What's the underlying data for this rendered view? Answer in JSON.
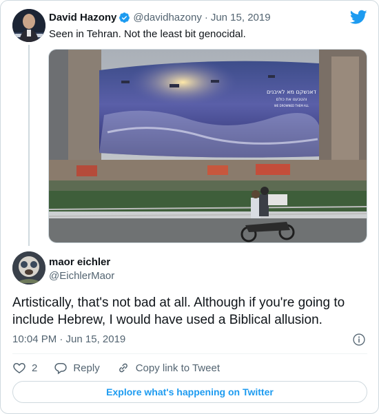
{
  "parent_tweet": {
    "author_name": "David Hazony",
    "handle": "@davidhazony",
    "separator": "·",
    "date": "Jun 15, 2019",
    "text": "Seen in Tehran. Not the least bit genocidal.",
    "billboard_lines": [
      "דאנשקם מא לאיבנים",
      "והטבענו את כולם",
      "WE DROWNED THEM ALL"
    ],
    "icons": {
      "verified": "verified-badge-icon",
      "brand": "twitter-bird-icon"
    }
  },
  "reply_tweet": {
    "author_name": "maor eichler",
    "handle": "@EichlerMaor",
    "text": "Artistically, that's not bad at all. Although if you're going to include Hebrew, I would have used a Biblical allusion.",
    "timestamp": "10:04 PM · Jun 15, 2019"
  },
  "actions": {
    "like_count": "2",
    "reply_label": "Reply",
    "copy_link_label": "Copy link to Tweet"
  },
  "footer": {
    "explore_label": "Explore what's happening on Twitter"
  },
  "colors": {
    "accent": "#1d9bf0",
    "muted_text": "#536471",
    "border": "#cfd9de"
  }
}
